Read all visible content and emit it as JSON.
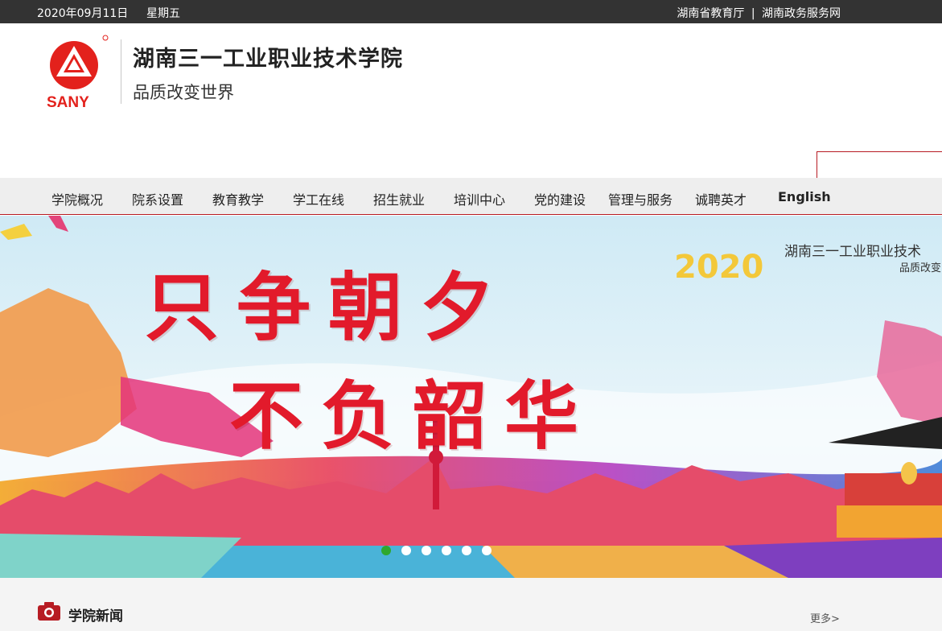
{
  "topbar": {
    "date": "2020年09月11日",
    "weekday": "星期五",
    "link_education": "湖南省教育厅",
    "separator": "|",
    "link_gov": "湖南政务服务网"
  },
  "header": {
    "logo_text": "SANY",
    "school_name": "湖南三一工业职业技术学院",
    "slogan": "品质改变世界",
    "search_placeholder": ""
  },
  "nav": {
    "items": [
      {
        "label": "学院概况"
      },
      {
        "label": "院系设置"
      },
      {
        "label": "教育教学"
      },
      {
        "label": "学工在线"
      },
      {
        "label": "招生就业"
      },
      {
        "label": "培训中心"
      },
      {
        "label": "党的建设"
      },
      {
        "label": "管理与服务"
      },
      {
        "label": "诚聘英才"
      },
      {
        "label": "English"
      }
    ]
  },
  "banner": {
    "line1": "只争朝夕",
    "line2": "不负韶华",
    "year": "2020",
    "caption": "湖南三一工业职业技术",
    "caption2": "品质改变",
    "slide_count": 6,
    "active_slide": 1
  },
  "news": {
    "title": "学院新闻",
    "more": "更多>"
  },
  "colors": {
    "brand_red": "#b71c23",
    "topbar_bg": "#333333",
    "active_dot": "#2fa82f"
  }
}
